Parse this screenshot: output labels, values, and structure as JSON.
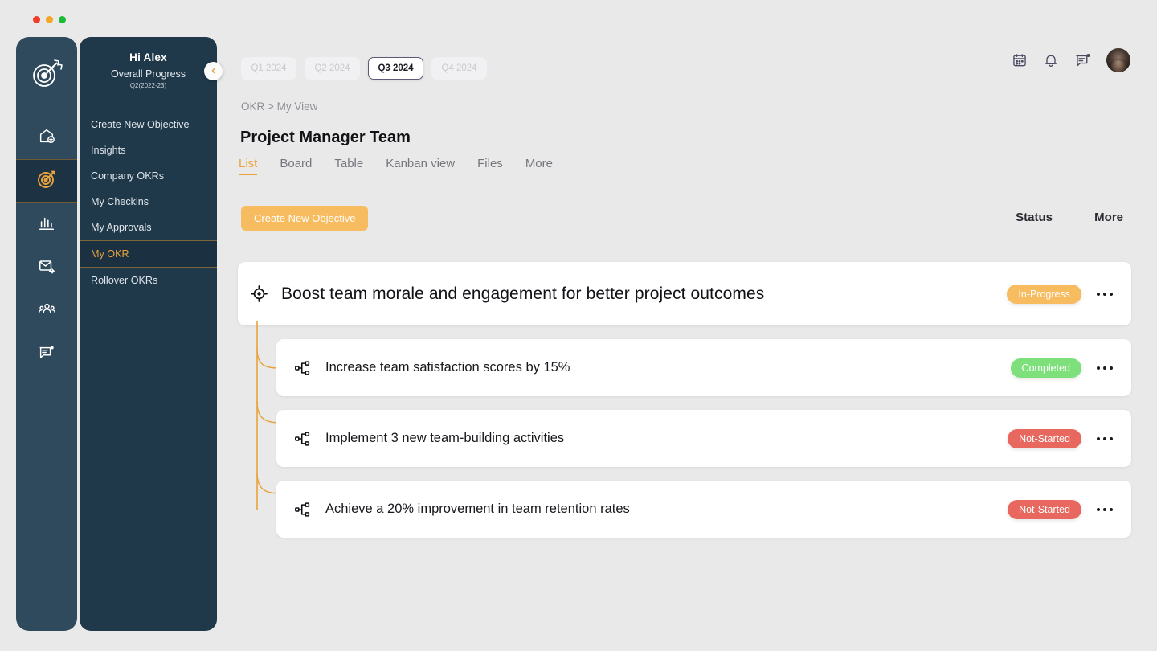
{
  "window": {
    "dots": [
      "red",
      "amber",
      "green"
    ]
  },
  "rail": {
    "logo_icon": "target-logo-icon",
    "items": [
      {
        "name": "home-add",
        "icon": "home-plus-icon",
        "active": false
      },
      {
        "name": "okr",
        "icon": "target-icon",
        "active": true
      },
      {
        "name": "analytics",
        "icon": "bar-chart-icon",
        "active": false
      },
      {
        "name": "mail",
        "icon": "mail-send-icon",
        "active": false
      },
      {
        "name": "team",
        "icon": "users-icon",
        "active": false
      },
      {
        "name": "feedback",
        "icon": "message-note-icon",
        "active": false
      }
    ]
  },
  "drawer": {
    "greeting": "Hi Alex",
    "subtitle": "Overall Progress",
    "period": "Q2(2022-23)",
    "collapse_icon": "chevron-left-icon",
    "items": [
      {
        "label": "Create New Objective",
        "active": false
      },
      {
        "label": "Insights",
        "active": false
      },
      {
        "label": "Company OKRs",
        "active": false
      },
      {
        "label": "My  Checkins",
        "active": false
      },
      {
        "label": "My Approvals",
        "active": false
      },
      {
        "label": "My OKR",
        "active": true
      },
      {
        "label": "Rollover OKRs",
        "active": false
      }
    ]
  },
  "quarters": [
    {
      "label": "Q1 2024",
      "active": false
    },
    {
      "label": "Q2 2024",
      "active": false
    },
    {
      "label": "Q3 2024",
      "active": true
    },
    {
      "label": "Q4 2024",
      "active": false
    }
  ],
  "topicons": [
    {
      "name": "calendar-icon"
    },
    {
      "name": "bell-icon"
    },
    {
      "name": "chat-icon"
    },
    {
      "name": "avatar"
    }
  ],
  "header": {
    "breadcrumb": "OKR > My View",
    "title": "Project Manager Team"
  },
  "viewtabs": [
    {
      "label": "List",
      "active": true
    },
    {
      "label": "Board",
      "active": false
    },
    {
      "label": "Table",
      "active": false
    },
    {
      "label": "Kanban view",
      "active": false
    },
    {
      "label": "Files",
      "active": false
    },
    {
      "label": "More",
      "active": false
    }
  ],
  "toolbar": {
    "create_label": "Create New Objective",
    "status_column": "Status",
    "more_column": "More"
  },
  "objective": {
    "icon": "crosshair-target-icon",
    "title": "Boost team morale and engagement for better project outcomes",
    "status": "In-Progress",
    "status_type": "inprogress",
    "kebab_icon": "ellipsis-icon"
  },
  "key_results": [
    {
      "icon": "hierarchy-icon",
      "title": "Increase team satisfaction scores by 15%",
      "status": "Completed",
      "status_type": "completed",
      "kebab_icon": "ellipsis-icon"
    },
    {
      "icon": "hierarchy-icon",
      "title": "Implement 3 new team-building activities",
      "status": "Not-Started",
      "status_type": "notstarted",
      "kebab_icon": "ellipsis-icon"
    },
    {
      "icon": "hierarchy-icon",
      "title": "Achieve a 20% improvement in team retention rates",
      "status": "Not-Started",
      "status_type": "notstarted",
      "kebab_icon": "ellipsis-icon"
    }
  ],
  "colors": {
    "accent_orange": "#e9a23b",
    "cta_yellow": "#f6bc5f",
    "sidebar_dark": "#20394a",
    "rail_dark": "#2f4a5c",
    "page_bg": "#e9e9e9",
    "status_completed": "#7de07a",
    "status_notstarted": "#e8685f",
    "connector": "#e9a23b"
  }
}
